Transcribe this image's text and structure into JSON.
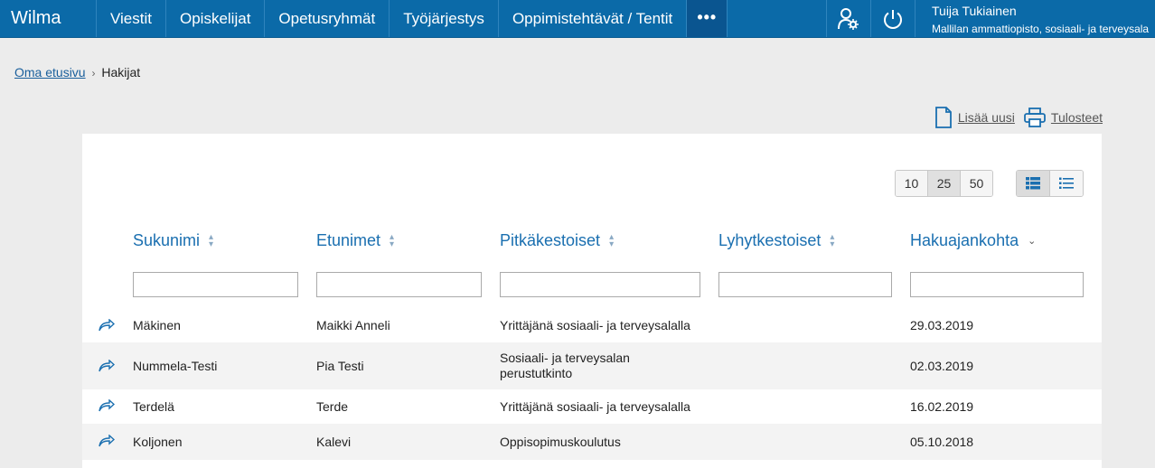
{
  "nav": {
    "brand": "Wilma",
    "items": [
      {
        "label": "Viestit"
      },
      {
        "label": "Opiskelijat"
      },
      {
        "label": "Opetusryhmät"
      },
      {
        "label": "Työjärjestys"
      },
      {
        "label": "Oppimistehtävät / Tentit"
      }
    ],
    "more_label": "•••"
  },
  "user": {
    "name": "Tuija Tukiainen",
    "organization": "Mallilan ammattiopisto, sosiaali- ja terveysala"
  },
  "breadcrumb": {
    "home": "Oma etusivu",
    "separator": "›",
    "current": "Hakijat"
  },
  "actions": {
    "add_new": "Lisää uusi",
    "prints": "Tulosteet"
  },
  "pager": {
    "options": [
      "10",
      "25",
      "50"
    ],
    "selected": "25"
  },
  "table": {
    "columns": [
      {
        "label": "Sukunimi",
        "sort": "both"
      },
      {
        "label": "Etunimet",
        "sort": "both"
      },
      {
        "label": "Pitkäkestoiset",
        "sort": "both"
      },
      {
        "label": "Lyhytkestoiset",
        "sort": "both"
      },
      {
        "label": "Hakuajankohta",
        "sort": "desc"
      }
    ],
    "rows": [
      {
        "surname": "Mäkinen",
        "firstnames": "Maikki Anneli",
        "long": "Yrittäjänä sosiaali- ja terveysalalla",
        "short": "",
        "date": "29.03.2019"
      },
      {
        "surname": "Nummela-Testi",
        "firstnames": "Pia Testi",
        "long": "Sosiaali- ja terveysalan perustutkinto",
        "short": "",
        "date": "02.03.2019"
      },
      {
        "surname": "Terdelä",
        "firstnames": "Terde",
        "long": "Yrittäjänä sosiaali- ja terveysalalla",
        "short": "",
        "date": "16.02.2019"
      },
      {
        "surname": "Koljonen",
        "firstnames": "Kalevi",
        "long": "Oppisopimuskoulutus",
        "short": "",
        "date": "05.10.2018"
      }
    ]
  },
  "colors": {
    "nav_bg": "#0b6aa8",
    "link": "#1a6fb0",
    "page_bg": "#ececec"
  }
}
